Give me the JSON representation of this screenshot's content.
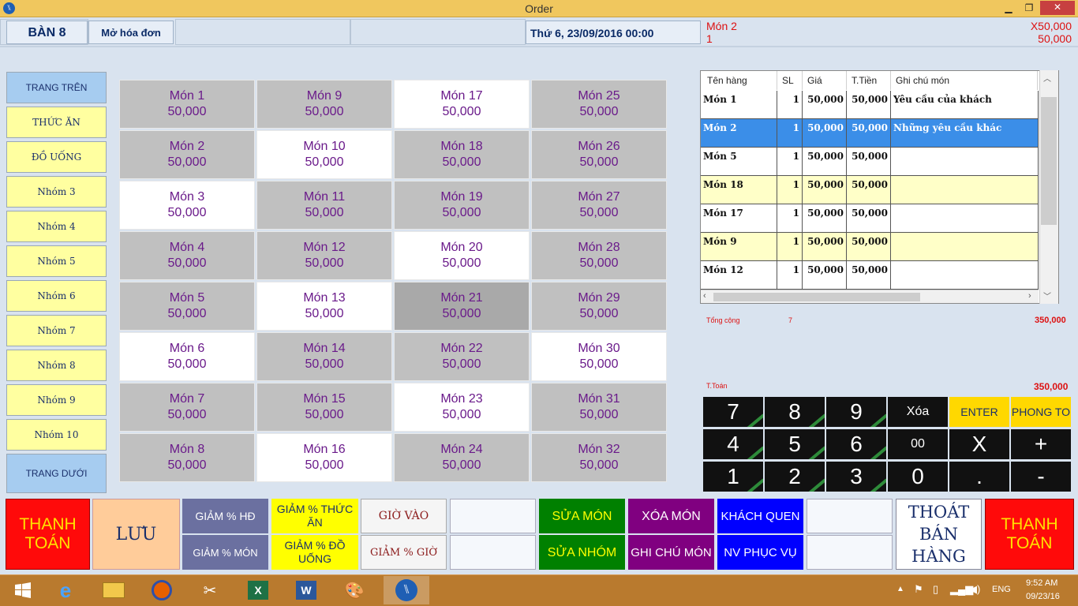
{
  "window": {
    "title": "Order",
    "min": "▁",
    "max": "❐",
    "close": "✕"
  },
  "header": {
    "table": "BÀN 8",
    "open_invoice": "Mở hóa đơn",
    "datetime": "Thứ 6, 23/09/2016  00:00",
    "item_name": "Món 2",
    "item_qty": "1",
    "item_price_line": "X50,000",
    "item_total": "50,000"
  },
  "groups": [
    "TRANG TRÊN",
    "THỨC ĂN",
    "ĐỒ UỐNG",
    "Nhóm 3",
    "Nhóm 4",
    "Nhóm 5",
    "Nhóm 6",
    "Nhóm 7",
    "Nhóm 8",
    "Nhóm 9",
    "Nhóm 10",
    "TRANG DƯỚI"
  ],
  "menu": [
    [
      "Món 1",
      "50,000"
    ],
    [
      "Món 9",
      "50,000"
    ],
    [
      "Món 17",
      "50,000"
    ],
    [
      "Món 25",
      "50,000"
    ],
    [
      "Món 2",
      "50,000"
    ],
    [
      "Món 10",
      "50,000"
    ],
    [
      "Món 18",
      "50,000"
    ],
    [
      "Món 26",
      "50,000"
    ],
    [
      "Món 3",
      "50,000"
    ],
    [
      "Món 11",
      "50,000"
    ],
    [
      "Món 19",
      "50,000"
    ],
    [
      "Món 27",
      "50,000"
    ],
    [
      "Món 4",
      "50,000"
    ],
    [
      "Món 12",
      "50,000"
    ],
    [
      "Món 20",
      "50,000"
    ],
    [
      "Món 28",
      "50,000"
    ],
    [
      "Món 5",
      "50,000"
    ],
    [
      "Món 13",
      "50,000"
    ],
    [
      "Món 21",
      "50,000"
    ],
    [
      "Món 29",
      "50,000"
    ],
    [
      "Món 6",
      "50,000"
    ],
    [
      "Món 14",
      "50,000"
    ],
    [
      "Món 22",
      "50,000"
    ],
    [
      "Món 30",
      "50,000"
    ],
    [
      "Món 7",
      "50,000"
    ],
    [
      "Món 15",
      "50,000"
    ],
    [
      "Món 23",
      "50,000"
    ],
    [
      "Món 31",
      "50,000"
    ],
    [
      "Món 8",
      "50,000"
    ],
    [
      "Món 16",
      "50,000"
    ],
    [
      "Món 24",
      "50,000"
    ],
    [
      "Món 32",
      "50,000"
    ]
  ],
  "order": {
    "columns": [
      "Tên hàng",
      "SL",
      "Giá",
      "T.Tiền",
      "Ghi chú món"
    ],
    "rows": [
      [
        "Món 1",
        "1",
        "50,000",
        "50,000",
        "Yêu cầu của khách"
      ],
      [
        "Món 2",
        "1",
        "50,000",
        "50,000",
        "Những yêu cầu khác"
      ],
      [
        "Món 5",
        "1",
        "50,000",
        "50,000",
        ""
      ],
      [
        "Món 18",
        "1",
        "50,000",
        "50,000",
        ""
      ],
      [
        "Món 17",
        "1",
        "50,000",
        "50,000",
        ""
      ],
      [
        "Món 9",
        "1",
        "50,000",
        "50,000",
        ""
      ],
      [
        "Món 12",
        "1",
        "50,000",
        "50,000",
        ""
      ]
    ],
    "total_label": "Tổng cộng",
    "total_qty": "7",
    "total_amount": "350,000",
    "pay_label": "T.Toán",
    "pay_amount": "350,000"
  },
  "keypad": [
    [
      "7",
      "8",
      "9",
      "Xóa",
      "ENTER",
      "PHONG TO"
    ],
    [
      "4",
      "5",
      "6",
      "00",
      "X",
      "+"
    ],
    [
      "1",
      "2",
      "3",
      "0",
      ".",
      "-"
    ]
  ],
  "bottom": {
    "pay1": "THANH TOÁN",
    "save": "LƯU",
    "disc_invoice": "GIẢM % HĐ",
    "disc_item": "GIẢM % MÓN",
    "disc_food": "GIẢM % THỨC ĂN",
    "disc_drink": "GIẢM % ĐỒ UỐNG",
    "time_in": "GIỜ VÀO",
    "disc_hour": "GIẢM % GIỜ",
    "edit_item": "SỬA MÓN",
    "edit_group": "SỬA NHÓM",
    "delete_item": "XÓA MÓN",
    "note_item": "GHI CHÚ MÓN",
    "regular": "KHÁCH QUEN",
    "staff": "NV PHỤC VỤ",
    "exit": "THOÁT BÁN HÀNG",
    "pay2": "THANH TOÁN"
  },
  "taskbar": {
    "lang": "ENG",
    "time": "9:52 AM",
    "date": "09/23/16"
  }
}
